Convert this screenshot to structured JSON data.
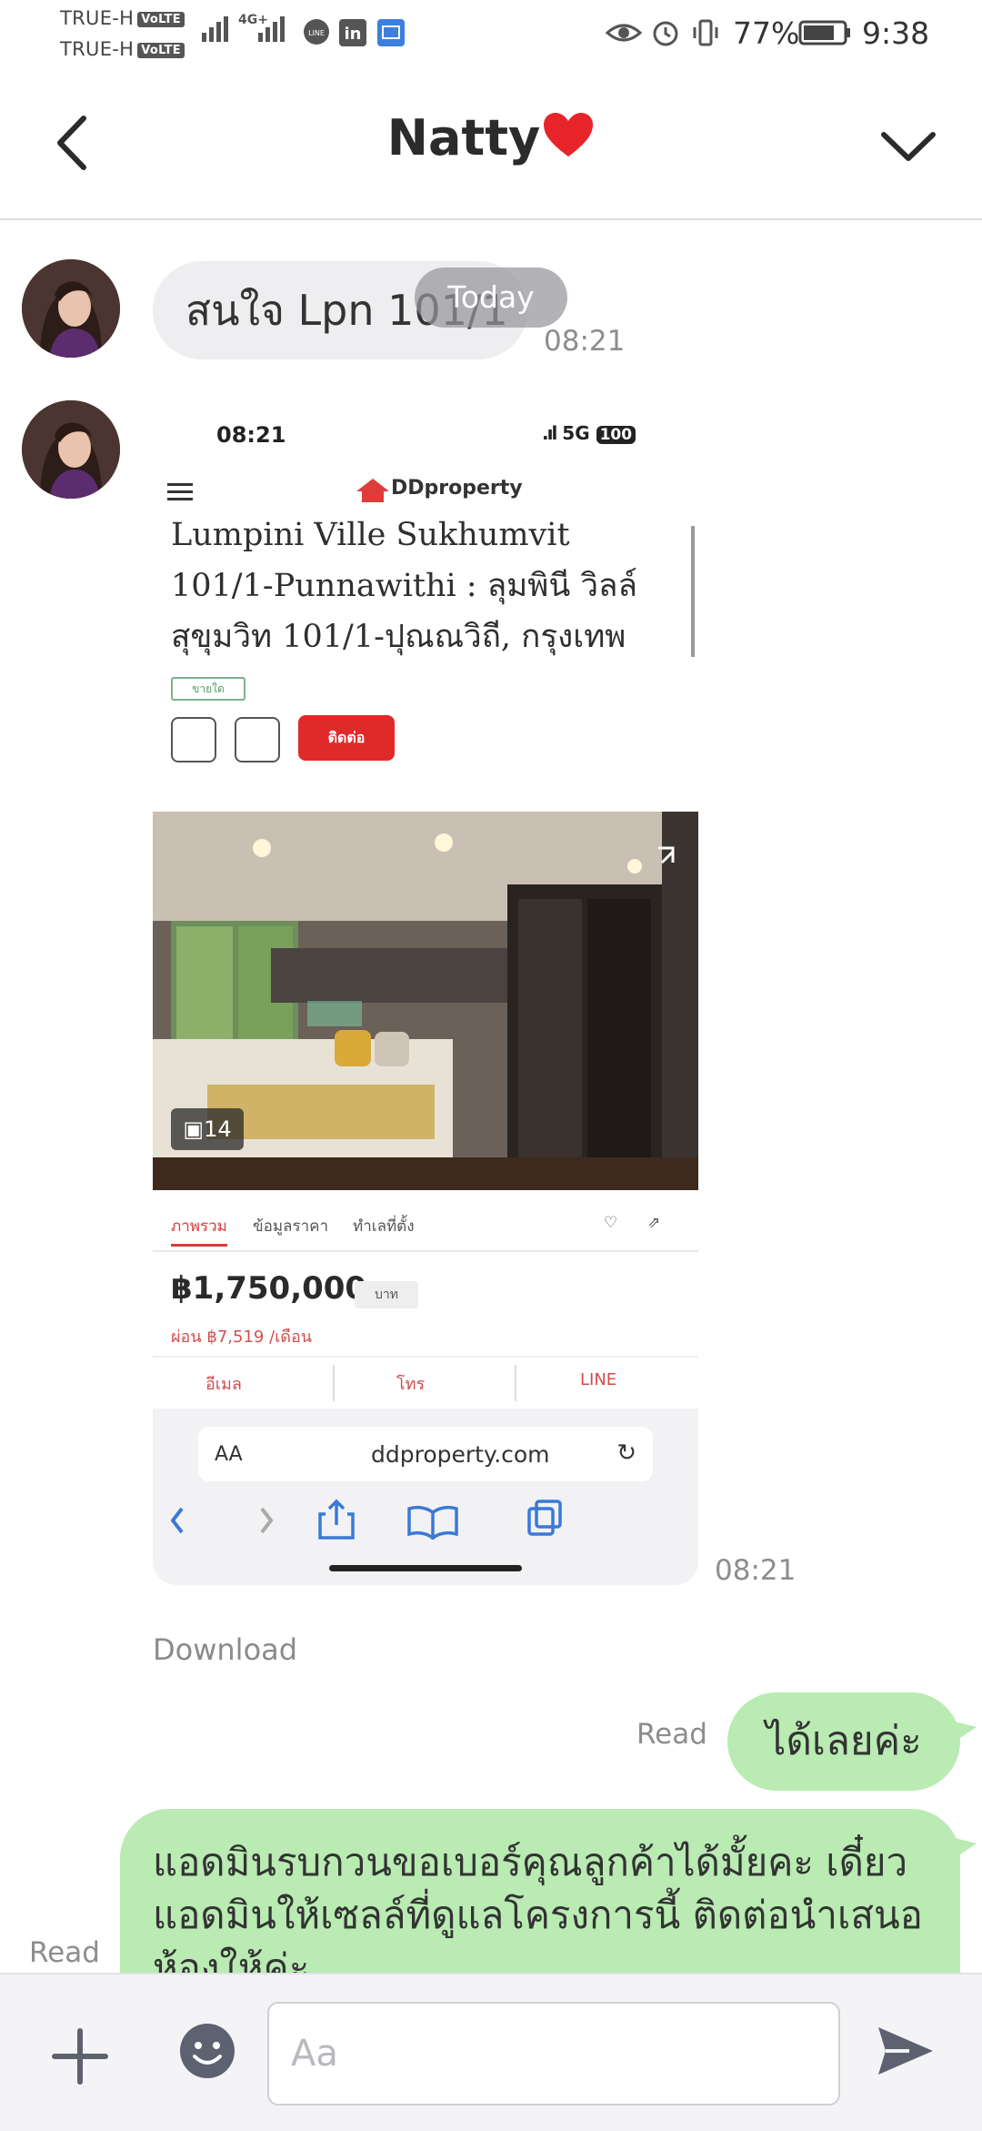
{
  "status_bar": {
    "carrier_1": "TRUE-H",
    "carrier_2": "TRUE-H",
    "volte_label": "VoLTE",
    "network_label": "4G+",
    "battery": "77%",
    "time": "9:38"
  },
  "header": {
    "title": "Natty"
  },
  "chat": {
    "date_label": "Today",
    "download_label": "Download",
    "messages": [
      {
        "text": "สนใจ Lpn 101/1",
        "time": "08:21"
      },
      {
        "time": "08:21",
        "image": {
          "status_time": "08:21",
          "status_signal": "5G",
          "battery": "100",
          "brand": "DDproperty",
          "title": "Lumpini Ville Sukhumvit 101/1-Punnawithi : ลุมพินี วิลล์ สุขุมวิท 101/1-ปุณณวิถี, กรุงเทพ",
          "tag": "ขายใด",
          "button": "ติดต่อ",
          "photo_count": "14",
          "tabs": [
            "ภาพรวม",
            "ข้อมูลราคา",
            "ทำเลที่ตั้ง"
          ],
          "price": "฿1,750,000",
          "price_unit": "บาท",
          "monthly": "ผ่อน ฿7,519 /เดือน",
          "actions": [
            "อีเมล",
            "โทร",
            "LINE"
          ],
          "url_prefix": "AA",
          "url": "ddproperty.com"
        }
      },
      {
        "text": "ได้เลยค่ะ",
        "status": "Read"
      },
      {
        "text": "แอดมินรบกวนขอเบอร์คุณลูกค้าได้มั้ยคะ เดี๋ยวแอดมินให้เซลล์ที่ดูแลโครงการนี้ ติดต่อนำเสนอห้องให้ค่ะ",
        "status": "Read"
      }
    ]
  },
  "input": {
    "placeholder": "Aa"
  },
  "colors": {
    "incoming_bubble": "#eeeef0",
    "outgoing_bubble": "#b9ebb3",
    "icon": "#5d6170"
  }
}
